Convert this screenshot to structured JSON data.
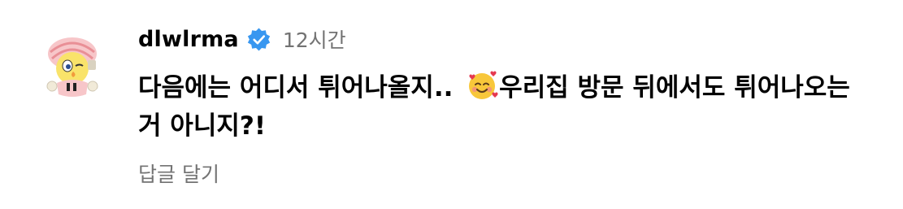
{
  "comment": {
    "author": {
      "username": "dlwlrma",
      "verified": true,
      "avatar_icon": "cartoon-bird-avatar-icon"
    },
    "timestamp": "12시간",
    "text_part1": "다음에는 어디서 튀어나올지.. ",
    "emoji_icon": "smiling-face-with-hearts-icon",
    "text_part2": "우리집 방문 뒤에서도 튀어나오는 거 아니지?!",
    "reply_label": "답글 달기"
  },
  "colors": {
    "text_primary": "#000000",
    "text_secondary": "#737373",
    "verified_badge": "#3897f0"
  }
}
